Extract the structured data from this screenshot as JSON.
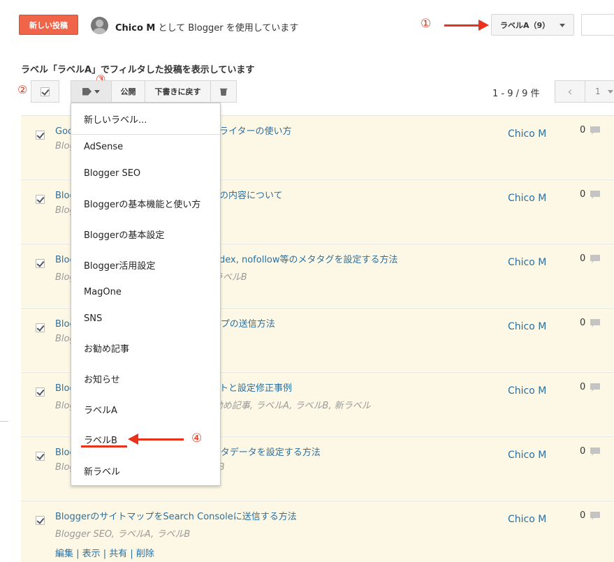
{
  "header": {
    "new_post_label": "新しい投稿",
    "user_name": "Chico M",
    "using_suffix": " として Blogger を使用しています",
    "label_filter_value": "ラベルA（9）"
  },
  "annotations": [
    "①",
    "②",
    "③",
    "④"
  ],
  "filter_heading": "ラベル「ラベルA」でフィルタした投稿を表示しています",
  "toolbar": {
    "publish_label": "公開",
    "revert_draft_label": "下書きに戻す",
    "count_text": "1 - 9 / 9 件",
    "page_value": "1"
  },
  "label_menu": {
    "new_label": "新しいラベル...",
    "items": [
      "AdSense",
      "Blogger SEO",
      "Bloggerの基本機能と使い方",
      "Bloggerの基本設定",
      "Blogger活用設定",
      "MagOne",
      "SNS",
      "お勧め記事",
      "お知らせ",
      "ラベルA",
      "ラベルB",
      "新ラベル"
    ]
  },
  "posts": [
    {
      "title_a": "Goo",
      "title_b": "ライターの使い方",
      "labels_a": "Blog",
      "labels_b": "",
      "author": "Chico M",
      "comments": "0"
    },
    {
      "title_a": "Blogg",
      "title_b": "の内容について",
      "labels_a": "Blog",
      "labels_b": "",
      "author": "Chico M",
      "comments": "0"
    },
    {
      "title_a": "Blogg",
      "title_b": "dex, nofollow等のメタタグを設定する方法",
      "labels_a": "Blog",
      "labels_b": "ラベルB",
      "author": "Chico M",
      "comments": "0"
    },
    {
      "title_a": "Blog",
      "title_b": "プの送信方法",
      "labels_a": "Blog",
      "labels_b": "",
      "author": "Chico M",
      "comments": "0"
    },
    {
      "title_a": "Blogg",
      "title_b": "トと設定修正事例",
      "labels_a": "Blog",
      "labels_b": "勧め記事, ラベルA, ラベルB, 新ラベル",
      "author": "Chico M",
      "comments": "0"
    },
    {
      "title_a": "Blog",
      "title_b": "タデータを設定する方法",
      "labels_a": "Blog",
      "labels_b": "B",
      "author": "Chico M",
      "comments": "0"
    },
    {
      "title_a": "Bloggerのサイトマップを",
      "title_b": "Search Consoleに送信する方法",
      "labels_a": "Blogger SEO, ラベルA, ",
      "labels_b": "ラベルB",
      "author": "Chico M",
      "comments": "0"
    }
  ],
  "post_actions": "編集 | 表示 | 共有 | 削除",
  "colors": {
    "accent_orange": "#f0654a",
    "annotation_red": "#e8321b",
    "link_blue": "#2a6fa0",
    "row_highlight": "#fdf8e6"
  }
}
